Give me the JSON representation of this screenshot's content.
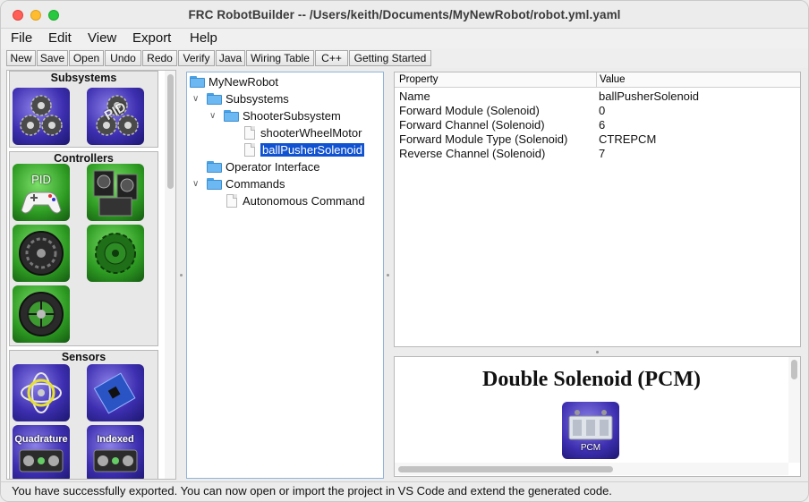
{
  "window": {
    "title": "FRC RobotBuilder -- /Users/keith/Documents/MyNewRobot/robot.yml.yaml"
  },
  "menu": [
    "File",
    "Edit",
    "View",
    "Export",
    "Help"
  ],
  "toolbar": [
    "New",
    "Save",
    "Open",
    "Undo",
    "Redo",
    "Verify",
    "Java",
    "Wiring Table",
    "C++",
    "Getting Started"
  ],
  "palette": {
    "sections": {
      "subsystems": "Subsystems",
      "controllers": "Controllers",
      "sensors": "Sensors"
    },
    "tile_labels": {
      "pid_subsystem": "PID",
      "pid_controller": "PID",
      "quadrature": "Quadrature",
      "indexed": "Indexed"
    }
  },
  "tree": {
    "root": "MyNewRobot",
    "subsystems": "Subsystems",
    "shooter": "ShooterSubsystem",
    "motor": "shooterWheelMotor",
    "solenoid": "ballPusherSolenoid",
    "oi": "Operator Interface",
    "commands": "Commands",
    "autonomous": "Autonomous Command"
  },
  "properties": {
    "header_property": "Property",
    "header_value": "Value",
    "rows": [
      {
        "name": "Name",
        "value": "ballPusherSolenoid"
      },
      {
        "name": "Forward Module (Solenoid)",
        "value": "0"
      },
      {
        "name": "Forward Channel (Solenoid)",
        "value": "6"
      },
      {
        "name": "Forward Module Type (Solenoid)",
        "value": "CTREPCM"
      },
      {
        "name": "Reverse Channel (Solenoid)",
        "value": "7"
      }
    ]
  },
  "help": {
    "title": "Double Solenoid (PCM)",
    "image_label": "PCM"
  },
  "status": {
    "message": "You have successfully exported. You can now open or import the project in VS Code and extend the generated code."
  },
  "colors": {
    "selection": "#1052d0",
    "tile_purple": "#3d2fb0",
    "tile_green": "#2d9a22",
    "folder": "#6cb8f2"
  }
}
